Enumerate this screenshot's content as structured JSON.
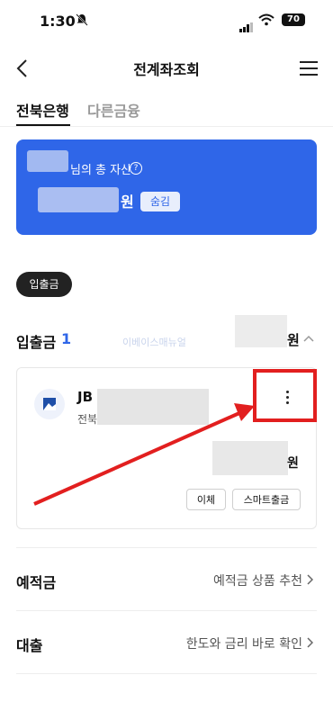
{
  "status": {
    "time": "1:30",
    "battery": "70"
  },
  "header": {
    "title": "전계좌조회"
  },
  "tabs": [
    {
      "label": "전북은행"
    },
    {
      "label": "다른금융"
    }
  ],
  "summary": {
    "total_label": "님의 총 자산",
    "info": "?",
    "currency": "원",
    "hide_label": "숨김"
  },
  "filter": {
    "chip": "입출금"
  },
  "section": {
    "title": "입출금",
    "count": "1",
    "currency": "원",
    "watermark": "이베이스매뉴얼"
  },
  "account": {
    "name": "JB",
    "sub": "전북",
    "currency": "원",
    "transfer_label": "이체",
    "smart_withdraw_label": "스마트출금"
  },
  "rows": [
    {
      "title": "예적금",
      "link": "예적금 상품 추천"
    },
    {
      "title": "대출",
      "link": "한도와 금리 바로 확인"
    }
  ],
  "colors": {
    "accent": "#2f66e8",
    "highlight": "#e21f1f"
  }
}
